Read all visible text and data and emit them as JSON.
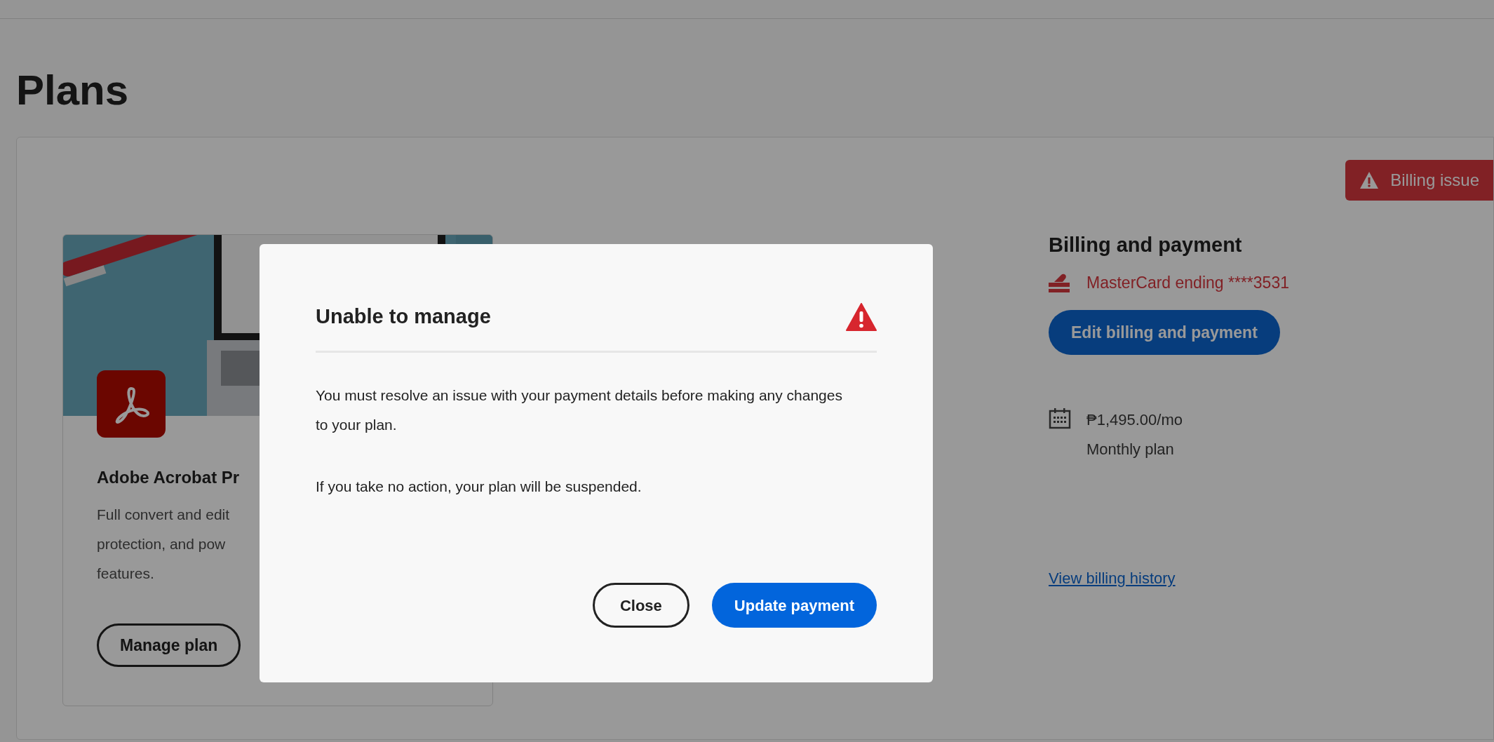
{
  "page": {
    "title": "Plans"
  },
  "plan_card": {
    "name": "Adobe Acrobat Pr",
    "description": [
      "Full convert and edit",
      "protection, and pow",
      "features."
    ],
    "button": "Manage plan"
  },
  "billing": {
    "badge": "Billing issue",
    "heading": "Billing and payment",
    "card": "MasterCard ending ****3531",
    "edit_button": "Edit billing and payment",
    "price": "₱1,495.00/mo",
    "plan_type": "Monthly plan",
    "history_link": "View billing history"
  },
  "dialog": {
    "title": "Unable to manage",
    "paragraphs": [
      "You must resolve an issue with your payment details before making any changes to your plan.",
      "If you take no action, your plan will be suspended."
    ],
    "buttons": [
      {
        "label": "Close",
        "kind": "secondary"
      },
      {
        "label": "Update payment",
        "kind": "primary"
      }
    ]
  }
}
